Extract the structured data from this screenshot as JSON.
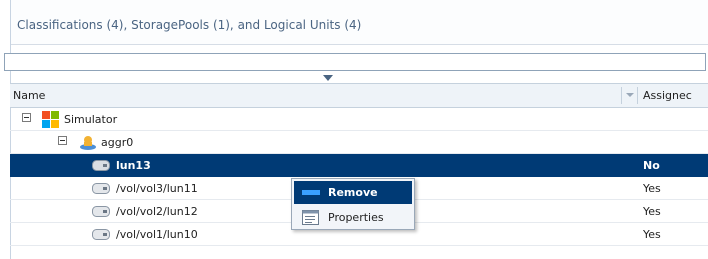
{
  "panel": {
    "title": "Classifications (4), StoragePools (1), and Logical Units (4)"
  },
  "filter": {
    "value": "",
    "placeholder": ""
  },
  "columns": {
    "name": "Name",
    "assigned": "Assignec"
  },
  "tree": [
    {
      "label": "Simulator",
      "icon": "windows-icon",
      "assigned": ""
    },
    {
      "label": "aggr0",
      "icon": "storage-pool-icon",
      "assigned": ""
    },
    {
      "label": "lun13",
      "icon": "disk-icon",
      "assigned": "No",
      "selected": true
    },
    {
      "label": "/vol/vol3/lun11",
      "icon": "disk-icon",
      "assigned": "Yes"
    },
    {
      "label": "/vol/vol2/lun12",
      "icon": "disk-icon",
      "assigned": "Yes"
    },
    {
      "label": "/vol/vol1/lun10",
      "icon": "disk-icon",
      "assigned": "Yes"
    }
  ],
  "context_menu": {
    "items": [
      {
        "label": "Remove",
        "icon": "remove-icon"
      },
      {
        "label": "Properties",
        "icon": "properties-icon"
      }
    ]
  },
  "colors": {
    "selection": "#003a75",
    "title_text": "#4a6482",
    "header_bg": "#eef3f8"
  }
}
